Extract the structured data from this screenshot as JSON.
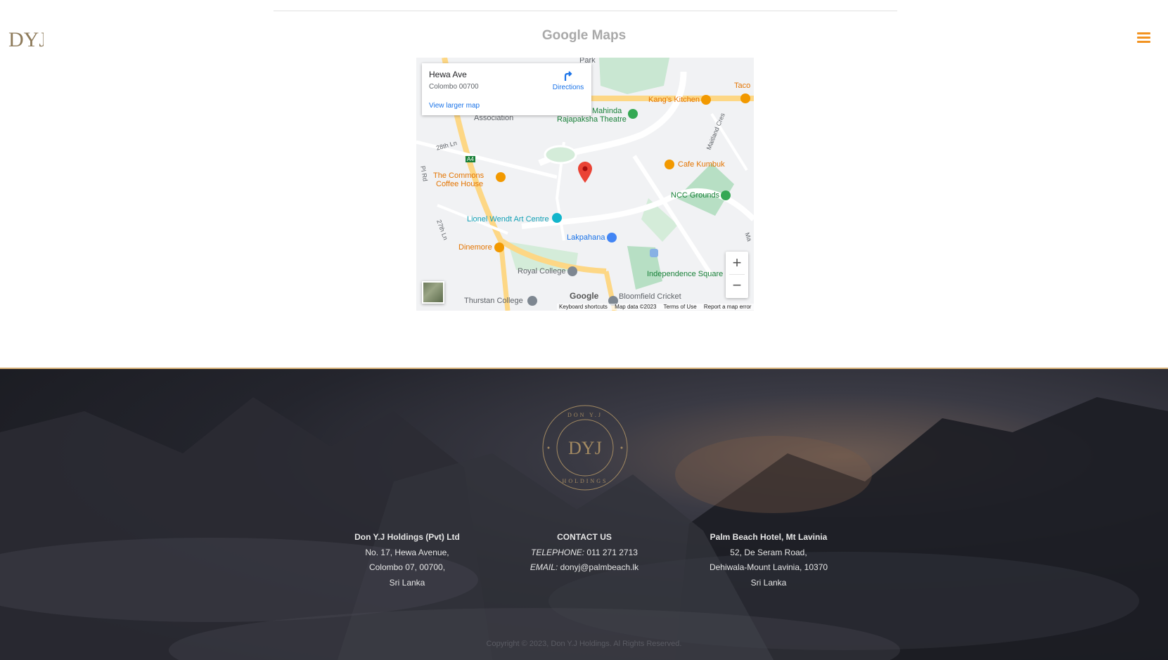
{
  "header": {
    "logo_text": "DYJ",
    "menu_icon": "hamburger-icon",
    "accent_color": "#f29321"
  },
  "section": {
    "title": "Google Maps"
  },
  "map": {
    "info": {
      "place": "Hewa Ave",
      "address": "Colombo 00700",
      "directions": "Directions",
      "larger_map": "View larger map"
    },
    "labels": {
      "park": "Park",
      "kangs_kitchen": "Kang's Kitchen",
      "taco": "Taco",
      "mahinda": "Mahinda",
      "rajapaksha": "Rajapaksha Theatre",
      "association": "Association",
      "maitland": "Maitland Cres",
      "ln28": "28th Ln",
      "a4": "A4",
      "cafe_kumbuk": "Cafe Kumbuk",
      "commons1": "The Commons",
      "commons2": "Coffee House",
      "pl_rd": "Pl Rd",
      "ncc": "NCC Grounds",
      "lionel": "Lionel Wendt Art Centre",
      "ln27": "27th Ln",
      "lakpahana": "Lakpahana",
      "dinemore": "Dinemore",
      "royal": "Royal College",
      "independence": "Independence Square",
      "thurstan": "Thurstan College",
      "bloomfield": "Bloomfield Cricket",
      "ma": "Ma"
    },
    "zoom_in": "+",
    "zoom_out": "−",
    "google": "Google",
    "footer": {
      "shortcuts": "Keyboard shortcuts",
      "data": "Map data ©2023",
      "terms": "Terms of Use",
      "report": "Report a map error"
    }
  },
  "footer": {
    "emblem": {
      "top": "DON Y.J",
      "center": "DYJ",
      "bottom": "HOLDINGS"
    },
    "col1": {
      "head": "Don Y.J Holdings (Pvt) Ltd",
      "line1": "No. 17, Hewa Avenue,",
      "line2": "Colombo 07, 00700,",
      "line3": "Sri Lanka"
    },
    "col2": {
      "head": "CONTACT US",
      "tel_label": "TELEPHONE:",
      "tel": "011 271 2713",
      "email_label": "EMAIL:",
      "email": "donyj@palmbeach.lk"
    },
    "col3": {
      "head": "Palm Beach Hotel, Mt Lavinia",
      "line1": "52, De Seram Road,",
      "line2": "Dehiwala-Mount Lavinia, 10370",
      "line3": "Sri Lanka"
    },
    "copyright": "Copyright © 2023, Don Y.J Holdings. Al Rights Reserved."
  }
}
